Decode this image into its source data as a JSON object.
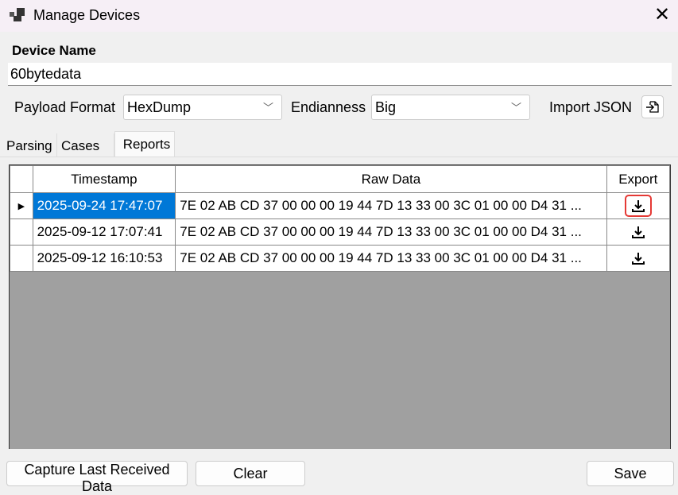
{
  "window": {
    "title": "Manage Devices"
  },
  "device_name": {
    "label": "Device Name",
    "value": "60bytedata"
  },
  "payload_format": {
    "label": "Payload Format",
    "value": "HexDump"
  },
  "endianness": {
    "label": "Endianness",
    "value": "Big"
  },
  "import_json": {
    "label": "Import JSON"
  },
  "tabs": [
    {
      "label": "Parsing"
    },
    {
      "label": "Cases"
    },
    {
      "label": "Reports",
      "selected": true
    }
  ],
  "table": {
    "columns": [
      "Timestamp",
      "Raw Data",
      "Export"
    ],
    "rows": [
      {
        "timestamp": "2025-09-24 17:47:07",
        "raw": "7E 02 AB CD 37 00 00 00 19 44 7D 13 33 00 3C 01 00 00 D4 31 ...",
        "selected": true
      },
      {
        "timestamp": "2025-09-12 17:07:41",
        "raw": "7E 02 AB CD 37 00 00 00 19 44 7D 13 33 00 3C 01 00 00 D4 31 ..."
      },
      {
        "timestamp": "2025-09-12 16:10:53",
        "raw": "7E 02 AB CD 37 00 00 00 19 44 7D 13 33 00 3C 01 00 00 D4 31 ..."
      }
    ]
  },
  "buttons": {
    "capture": "Capture Last Received Data",
    "clear": "Clear",
    "save": "Save"
  },
  "colors": {
    "selection": "#0078d7",
    "highlight": "#e53935",
    "empty_grid": "#a0a0a0"
  }
}
